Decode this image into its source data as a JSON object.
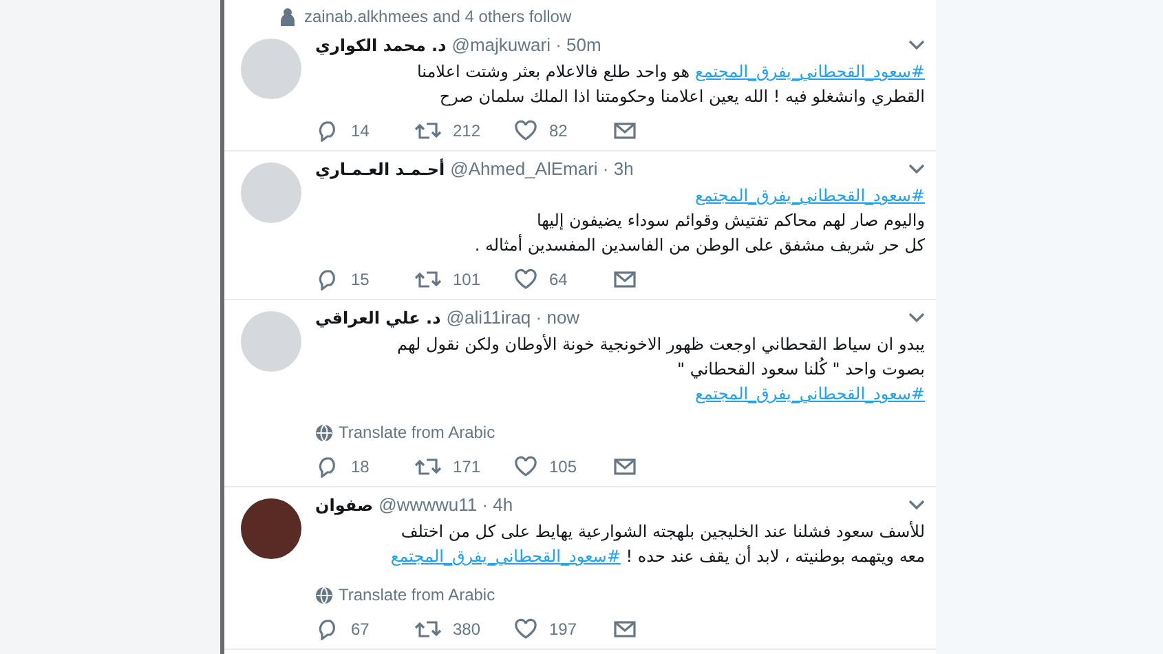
{
  "social_context": {
    "text": "zainab.alkhmees and 4 others follow"
  },
  "tweets": [
    {
      "name": "د. محمد الكواري",
      "handle": "@majkuwari · 50m",
      "lines": [
        [
          {
            "kind": "hashtag",
            "text": "#سعود_القحطاني_يفرق_المجتمع"
          },
          {
            "kind": "plain",
            "text": " هو واحد طلع فالاعلام بعثر وشتت اعلامنا"
          }
        ],
        [
          {
            "kind": "plain",
            "text": "القطري وانشغلو فيه ! الله يعين اعلامنا وحكومتنا اذا الملك سلمان صرح"
          }
        ]
      ],
      "replies": "14",
      "retweets": "212",
      "likes": "82"
    },
    {
      "name": "أحـمـد العـمـاري",
      "handle": "@Ahmed_AlEmari · 3h",
      "lines": [
        [
          {
            "kind": "hashtag",
            "text": "#سعود_القحطاني_يفرق_المجتمع"
          }
        ],
        [
          {
            "kind": "plain",
            "text": "واليوم صار لهم محاكم تفتيش وقوائم سوداء يضيفون إليها"
          }
        ],
        [
          {
            "kind": "plain",
            "text": "كل حر شريف مشفق على الوطن من الفاسدين المفسدين أمثاله ."
          }
        ]
      ],
      "replies": "15",
      "retweets": "101",
      "likes": "64"
    },
    {
      "name": "د. علي العراقي",
      "handle": "@ali11iraq · now",
      "lines": [
        [
          {
            "kind": "plain",
            "text": "يبدو ان سياط القحطاني اوجعت ظهور الاخونجية خونة الأوطان ولكن نقول لهم"
          }
        ],
        [
          {
            "kind": "plain",
            "text": "بصوت واحد \" كُلنا سعود القحطاني \""
          }
        ],
        [
          {
            "kind": "hashtag",
            "text": "#سعود_القحطاني_يفرق_المجتمع"
          }
        ]
      ],
      "translate": "Translate from Arabic",
      "replies": "18",
      "retweets": "171",
      "likes": "105"
    },
    {
      "name": "صفوان",
      "handle": "@wwwwu11 · 4h",
      "lines": [
        [
          {
            "kind": "plain",
            "text": "للأسف سعود فشلنا عند الخليجين بلهجته الشوارعية يهايط على كل من اختلف"
          }
        ],
        [
          {
            "kind": "plain",
            "text": "معه ويتهمه بوطنيته ، لابد أن يقف عند حده ! "
          },
          {
            "kind": "hashtag",
            "text": "#سعود_القحطاني_يفرق_المجتمع"
          }
        ]
      ],
      "translate": "Translate from Arabic",
      "replies": "67",
      "retweets": "380",
      "likes": "197"
    }
  ]
}
